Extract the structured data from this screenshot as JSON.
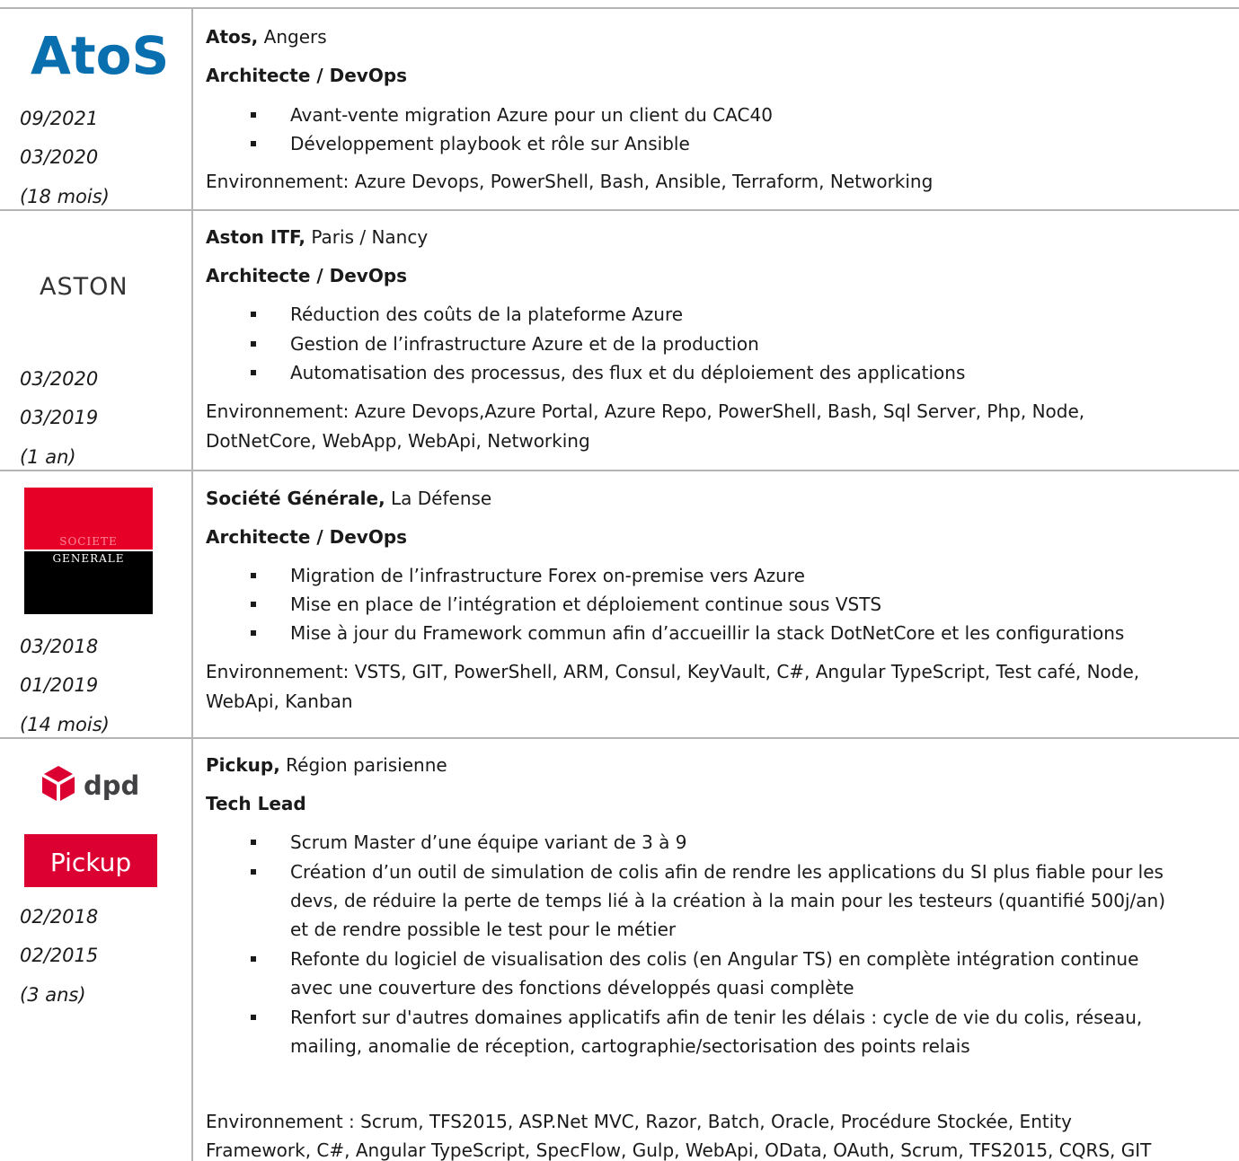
{
  "entries": [
    {
      "company": "Atos,",
      "location": " Angers",
      "role": "Architecte / DevOps",
      "bullets": [
        "Avant-vente migration Azure pour un client du CAC40",
        "Développement playbook et rôle sur Ansible"
      ],
      "env": [
        "Environnement: Azure Devops, PowerShell, Bash, Ansible, Terraform, Networking"
      ],
      "dates": [
        "09/2021",
        "03/2020",
        "(18 mois)"
      ],
      "logo_text": "AtoS"
    },
    {
      "company": "Aston ITF,",
      "location": " Paris / Nancy",
      "role": "Architecte / DevOps",
      "bullets": [
        "Réduction des coûts de la plateforme Azure",
        "Gestion de l’infrastructure Azure et de la production",
        "Automatisation des processus, des flux et du déploiement des applications"
      ],
      "env": [
        "Environnement: Azure Devops,Azure Portal, Azure Repo, PowerShell, Bash, Sql Server, Php, Node,",
        "DotNetCore, WebApp, WebApi, Networking"
      ],
      "dates": [
        "03/2020",
        "03/2019",
        "(1 an)"
      ],
      "logo_text": "ASTON"
    },
    {
      "company": "Société Générale,",
      "location": " La Défense",
      "role": "Architecte / DevOps",
      "bullets": [
        "Migration de l’infrastructure Forex on-premise vers Azure",
        "Mise en place de l’intégration et déploiement continue sous VSTS",
        "Mise à jour du Framework commun afin d’accueillir la stack DotNetCore et les configurations"
      ],
      "env": [
        "Environnement: VSTS, GIT, PowerShell, ARM, Consul, KeyVault, C#, Angular TypeScript, Test café, Node,",
        "WebApi, Kanban"
      ],
      "dates": [
        "03/2018",
        "01/2019",
        "(14 mois)"
      ],
      "logo_text": [
        "SOCIETE",
        "GENERALE"
      ]
    },
    {
      "company": "Pickup,",
      "location": " Région parisienne",
      "role": "Tech Lead",
      "bullets": [
        "Scrum Master d’une équipe variant de 3 à 9",
        "Création d’un outil de simulation de colis afin de rendre les applications du SI plus fiable pour les",
        "devs, de réduire la perte de temps lié à la création à la main pour les testeurs (quantifié 500j/an)",
        "et de rendre possible le test pour le métier",
        "Refonte du logiciel de visualisation des colis (en Angular TS) en complète intégration continue",
        "avec une couverture des fonctions développés quasi complète",
        "Renfort sur d'autres domaines applicatifs afin de tenir les délais : cycle de vie du colis, réseau,",
        "mailing, anomalie de réception, cartographie/sectorisation des points relais"
      ],
      "env": [
        "Environnement : Scrum, TFS2015, ASP.Net MVC, Razor, Batch, Oracle, Procédure Stockée, Entity",
        "Framework, C#, Angular TypeScript, SpecFlow, Gulp, WebApi, OData, OAuth, Scrum, TFS2015, CQRS, GIT"
      ],
      "dates": [
        "02/2018",
        "02/2015",
        "(3 ans)"
      ],
      "logo_text": [
        "dpd",
        "Pickup"
      ]
    }
  ],
  "colors": {
    "atos_blue": "#0a6fae",
    "sg_red": "#e60028",
    "sg_black": "#000000",
    "dpd_red": "#dc0032",
    "rule_gray": "#b5b5b5"
  }
}
